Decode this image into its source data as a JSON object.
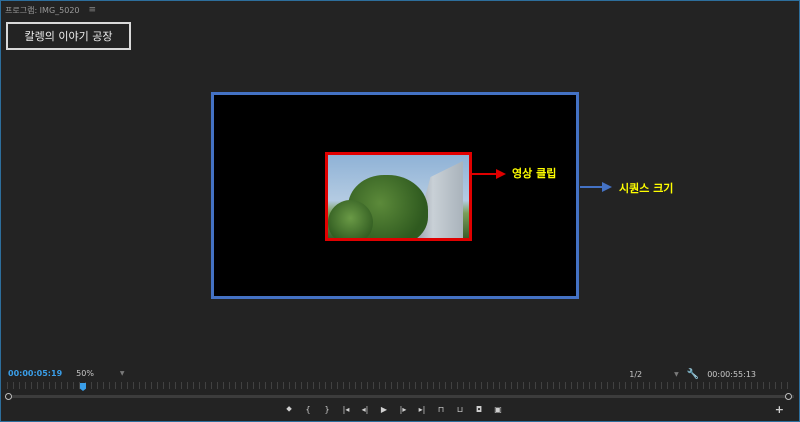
{
  "panel": {
    "title": "프로그램: IMG_5020",
    "menu_icon": "≡"
  },
  "overlay": {
    "channel_label": "칼렝의 이야기 공장",
    "clip_annotation": "영상 클립",
    "sequence_annotation": "시퀀스 크기",
    "colors": {
      "clip_border": "#e00000",
      "sequence_border": "#4472c4",
      "annotation_text": "#ffff00"
    }
  },
  "controls": {
    "current_timecode": "00:00:05:19",
    "zoom_level": "50%",
    "resolution": "1/2",
    "duration_timecode": "00:00:55:13"
  },
  "transport_icons": [
    "marker-icon",
    "in-point-icon",
    "out-point-icon",
    "go-to-in-icon",
    "step-back-icon",
    "play-icon",
    "step-forward-icon",
    "go-to-out-icon",
    "lift-icon",
    "extract-icon",
    "export-frame-icon",
    "compare-icon"
  ],
  "accent": "#3a9ee8"
}
